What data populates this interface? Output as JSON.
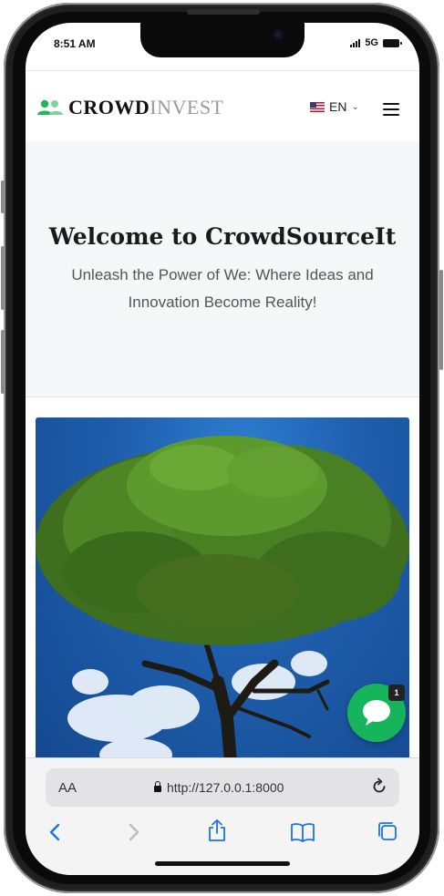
{
  "status_bar": {
    "time": "8:51 AM",
    "network": "5G"
  },
  "nav": {
    "logo_part1": "CROWD",
    "logo_part2": "INVEST",
    "language": "EN",
    "icons": {
      "logo": "people-icon",
      "flag": "us-flag-icon",
      "menu": "hamburger-menu-icon"
    }
  },
  "hero": {
    "title": "Welcome to CrowdSourceIt",
    "subtitle": "Unleash the Power of We: Where Ideas and Innovation Become Reality!"
  },
  "chat": {
    "badge_count": "1",
    "icon": "chat-bubble-icon"
  },
  "browser": {
    "text_size": "AA",
    "url": "http://127.0.0.1:8000",
    "toolbar": [
      "back-icon",
      "forward-icon",
      "share-icon",
      "bookmarks-icon",
      "tabs-icon"
    ]
  },
  "colors": {
    "brand_green": "#16b55b",
    "ios_blue": "#1a73e8"
  }
}
